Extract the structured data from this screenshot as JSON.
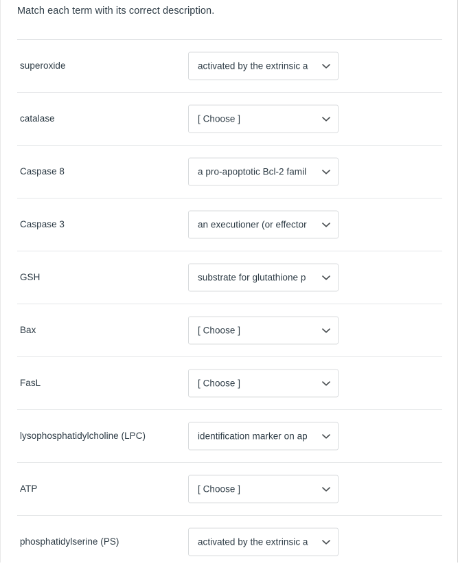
{
  "question": {
    "prompt": "Match each term with its correct description."
  },
  "placeholder": "[ Choose ]",
  "chevron_icon": "chevron-down-icon",
  "colors": {
    "text": "#2d3b45",
    "divider": "#e4e6e8",
    "select_border": "#d8dbdd",
    "background": "#ffffff"
  },
  "rows": [
    {
      "term": "superoxide",
      "selected": "activated by the extrinsic a"
    },
    {
      "term": "catalase",
      "selected": "[ Choose ]"
    },
    {
      "term": "Caspase 8",
      "selected": "a pro-apoptotic Bcl-2 famil"
    },
    {
      "term": "Caspase 3",
      "selected": "an executioner (or effector"
    },
    {
      "term": "GSH",
      "selected": "substrate for glutathione p"
    },
    {
      "term": "Bax",
      "selected": "[ Choose ]"
    },
    {
      "term": "FasL",
      "selected": "[ Choose ]"
    },
    {
      "term": "lysophosphatidylcholine (LPC)",
      "selected": "identification marker on ap"
    },
    {
      "term": "ATP",
      "selected": "[ Choose ]"
    },
    {
      "term": "phosphatidylserine (PS)",
      "selected": "activated by the extrinsic a"
    }
  ]
}
